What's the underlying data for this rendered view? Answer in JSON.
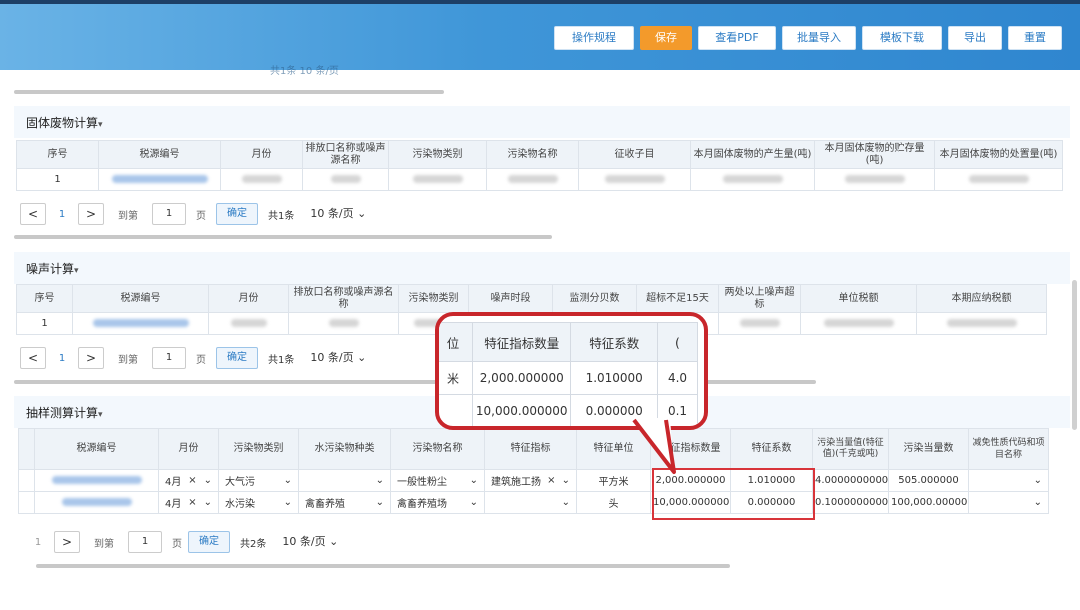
{
  "toolbar": {
    "buttons": [
      "操作规程",
      "保存",
      "查看PDF",
      "批量导入",
      "模板下载",
      "导出",
      "重置"
    ],
    "behind_pager": "共1条   10 条/页"
  },
  "solid_waste": {
    "title": "固体废物计算",
    "columns": [
      "序号",
      "税源编号",
      "月份",
      "排放口名称或噪声源名称",
      "污染物类别",
      "污染物名称",
      "征收子目",
      "本月固体废物的产生量(吨)",
      "本月固体废物的贮存量(吨)",
      "本月固体废物的处置量(吨)"
    ],
    "row_no": "1",
    "pager": {
      "prev": "<",
      "page": "1",
      "next": ">",
      "goto": "到第",
      "page_input": "1",
      "page_unit": "页",
      "confirm": "确定",
      "total": "共1条",
      "size": "10 条/页"
    }
  },
  "noise": {
    "title": "噪声计算",
    "columns": [
      "序号",
      "税源编号",
      "月份",
      "排放口名称或噪声源名称",
      "污染物类别",
      "噪声时段",
      "监测分贝数",
      "超标不足15天",
      "两处以上噪声超标",
      "单位税额",
      "本期应纳税额"
    ],
    "row_no": "1",
    "pager": {
      "prev": "<",
      "page": "1",
      "next": ">",
      "goto": "到第",
      "page_input": "1",
      "page_unit": "页",
      "confirm": "确定",
      "total": "共1条",
      "size": "10 条/页"
    }
  },
  "sampling": {
    "title": "抽样测算计算",
    "columns": [
      "税源编号",
      "月份",
      "污染物类别",
      "水污染物种类",
      "污染物名称",
      "特征指标",
      "特征单位",
      "特征指标数量",
      "特征系数",
      "污染当量值(特征值)(千克或吨)",
      "污染当量数",
      "减免性质代码和项目名称"
    ],
    "rows": [
      {
        "month": "4月",
        "category": "大气污",
        "water_type": "",
        "pollutant": "一般性粉尘",
        "indicator": "建筑施工扬",
        "unit": "平方米",
        "qty": "2,000.000000",
        "coef": "1.010000",
        "equiv_value": "4.0000000000",
        "equiv_count": "505.000000"
      },
      {
        "month": "4月",
        "category": "水污染",
        "water_type": "禽畜养殖",
        "pollutant": "禽畜养殖场",
        "indicator": "",
        "unit": "头",
        "qty": "10,000.000000",
        "coef": "0.000000",
        "equiv_value": "0.1000000000",
        "equiv_count": "100,000.000000"
      }
    ],
    "pager": {
      "page": "1",
      "next": ">",
      "goto": "到第",
      "page_input": "1",
      "page_unit": "页",
      "confirm": "确定",
      "total": "共2条",
      "size": "10 条/页"
    }
  },
  "callout": {
    "col_left": "位",
    "col_qty": "特征指标数量",
    "col_coef": "特征系数",
    "col_right": "(",
    "row1_left": "米",
    "row1_qty": "2,000.000000",
    "row1_coef": "1.010000",
    "row1_right": "4.0",
    "row2_qty": "10,000.000000",
    "row2_coef": "0.000000",
    "row2_right": "0.1"
  },
  "icons": {
    "clear": "×",
    "dropdown": "chevron-down",
    "prev": "chevron-left",
    "next": "chevron-right"
  },
  "colors": {
    "header_blue": "#3f96d8",
    "save_orange": "#f39a2b",
    "highlight_red": "#c8262b",
    "link_blue": "#2b7bc4"
  }
}
